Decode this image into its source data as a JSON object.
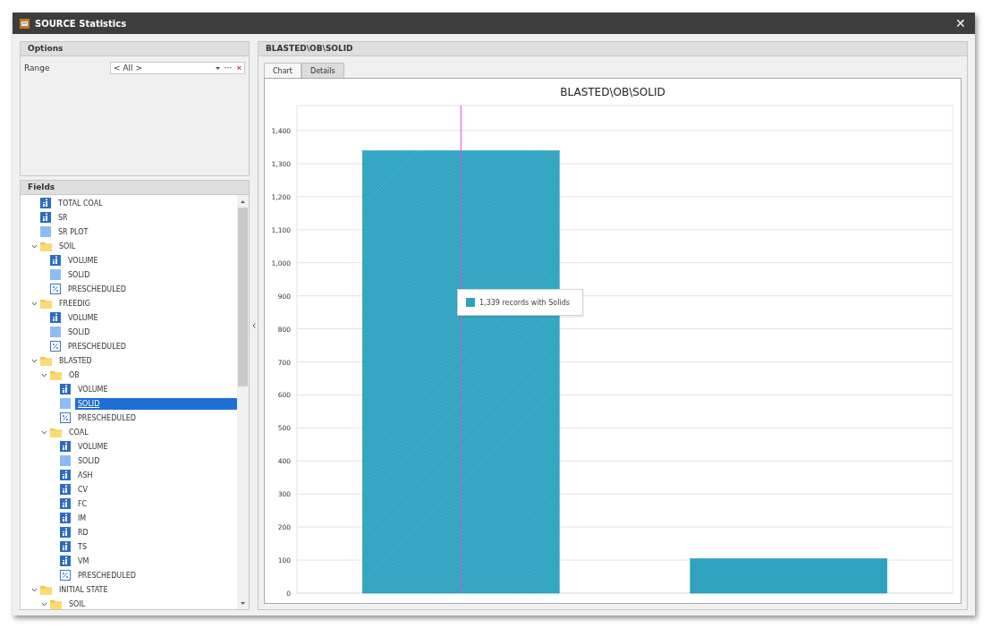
{
  "window": {
    "title": "SOURCE Statistics",
    "close_button": "✕"
  },
  "options": {
    "title": "Options",
    "range_label": "Range",
    "range_value": "< All >",
    "more_button": "···",
    "clear_button": "×"
  },
  "fields": {
    "title": "Fields",
    "items": [
      {
        "kind": "stat",
        "label": "TOTAL COAL",
        "selected": false
      },
      {
        "kind": "stat",
        "label": "SR",
        "selected": false
      },
      {
        "kind": "plain",
        "label": "SR PLOT",
        "selected": false
      },
      {
        "kind": "folder",
        "label": "SOIL",
        "expanded": true,
        "selected": false,
        "children": [
          {
            "kind": "stat",
            "label": "VOLUME",
            "selected": false
          },
          {
            "kind": "plain",
            "label": "SOLID",
            "selected": false
          },
          {
            "kind": "percent",
            "label": "PRESCHEDULED",
            "selected": false
          }
        ]
      },
      {
        "kind": "folder",
        "label": "FREEDIG",
        "expanded": true,
        "selected": false,
        "children": [
          {
            "kind": "stat",
            "label": "VOLUME",
            "selected": false
          },
          {
            "kind": "plain",
            "label": "SOLID",
            "selected": false
          },
          {
            "kind": "percent",
            "label": "PRESCHEDULED",
            "selected": false
          }
        ]
      },
      {
        "kind": "folder",
        "label": "BLASTED",
        "expanded": true,
        "selected": false,
        "children": [
          {
            "kind": "folder",
            "label": "OB",
            "expanded": true,
            "selected": false,
            "children": [
              {
                "kind": "stat",
                "label": "VOLUME",
                "selected": false
              },
              {
                "kind": "plain",
                "label": "SOLID",
                "selected": true
              },
              {
                "kind": "percent",
                "label": "PRESCHEDULED",
                "selected": false
              }
            ]
          },
          {
            "kind": "folder",
            "label": "COAL",
            "expanded": true,
            "selected": false,
            "children": [
              {
                "kind": "stat",
                "label": "VOLUME",
                "selected": false
              },
              {
                "kind": "plain",
                "label": "SOLID",
                "selected": false
              },
              {
                "kind": "stat",
                "label": "ASH",
                "selected": false
              },
              {
                "kind": "stat",
                "label": "CV",
                "selected": false
              },
              {
                "kind": "stat",
                "label": "FC",
                "selected": false
              },
              {
                "kind": "stat",
                "label": "IM",
                "selected": false
              },
              {
                "kind": "stat",
                "label": "RD",
                "selected": false
              },
              {
                "kind": "stat",
                "label": "TS",
                "selected": false
              },
              {
                "kind": "stat",
                "label": "VM",
                "selected": false
              },
              {
                "kind": "percent",
                "label": "PRESCHEDULED",
                "selected": false
              }
            ]
          }
        ]
      },
      {
        "kind": "folder",
        "label": "INITIAL STATE",
        "expanded": true,
        "selected": false,
        "children": [
          {
            "kind": "folder",
            "label": "SOIL",
            "expanded": true,
            "selected": false
          }
        ]
      }
    ]
  },
  "detail": {
    "title": "BLASTED\\OB\\SOLID",
    "tabs": [
      {
        "label": "Chart",
        "selected": true
      },
      {
        "label": "Details",
        "selected": false
      }
    ],
    "tooltip": {
      "text": "1,339 records with Solids",
      "color": "#2ea2bf"
    },
    "chart_data": {
      "type": "bar",
      "grid": true,
      "title": "BLASTED\\OB\\SOLID",
      "values": [
        1339,
        104
      ],
      "color": "#2ea2bf",
      "ylim": [
        0,
        1476
      ],
      "yticks": [
        {
          "value": 0,
          "label": "0"
        },
        {
          "value": 100,
          "label": "100"
        },
        {
          "value": 200,
          "label": "200"
        },
        {
          "value": 300,
          "label": "300"
        },
        {
          "value": 400,
          "label": "400"
        },
        {
          "value": 500,
          "label": "500"
        },
        {
          "value": 600,
          "label": "600"
        },
        {
          "value": 700,
          "label": "700"
        },
        {
          "value": 800,
          "label": "800"
        },
        {
          "value": 900,
          "label": "900"
        },
        {
          "value": 1000,
          "label": "1,000"
        },
        {
          "value": 1100,
          "label": "1,100"
        },
        {
          "value": 1200,
          "label": "1,200"
        },
        {
          "value": 1300,
          "label": "1,300"
        },
        {
          "value": 1400,
          "label": "1,400"
        }
      ]
    }
  }
}
